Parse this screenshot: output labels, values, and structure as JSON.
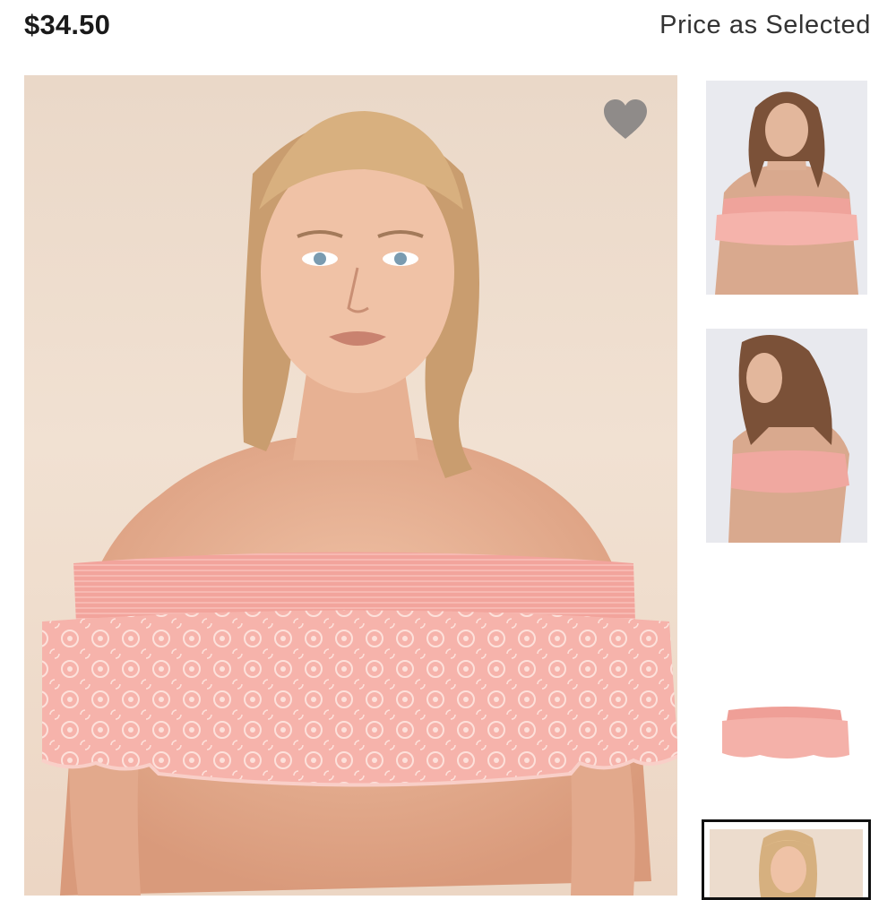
{
  "product": {
    "price": "$34.50",
    "price_note": "Price as Selected"
  },
  "icons": {
    "favorite": "heart-icon"
  },
  "colors": {
    "lace_pink": "#f4aaa4",
    "background_beige": "#ecd9c9",
    "heart_gray": "#8f8b89"
  }
}
